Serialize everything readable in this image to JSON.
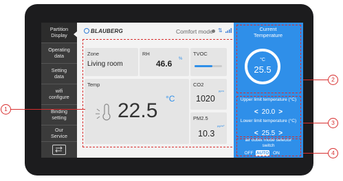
{
  "sidebar": {
    "items": [
      {
        "label": "Partition Display"
      },
      {
        "label": "Operating data"
      },
      {
        "label": "Setting data"
      },
      {
        "label": "wifi configure"
      },
      {
        "label": "Binding setting"
      },
      {
        "label": "Our Service"
      }
    ]
  },
  "header": {
    "brand": "BLAUBERG",
    "mode": "Comfort mode"
  },
  "cards": {
    "zone": {
      "label": "Zone",
      "value": "Living room"
    },
    "rh": {
      "label": "RH",
      "value": "46.6",
      "unit": "%"
    },
    "tvoc": {
      "label": "TVOC",
      "level": 0.65
    },
    "temp": {
      "label": "Temp",
      "value": "22.5",
      "unit": "°C"
    },
    "co2": {
      "label": "CO2",
      "value": "1020",
      "unit": "ppm"
    },
    "pm25": {
      "label": "PM2.5",
      "value": "10.3",
      "unit": "μg/m³"
    }
  },
  "panel": {
    "title": "Current Temperature",
    "unit": "°C",
    "current": "25.5",
    "upper_label": "Upper limit temperature (°C)",
    "upper_value": "20.0",
    "lower_label": "Lower limit temperature (°C)",
    "lower_value": "25.5",
    "switch_label": "air outlet mode selector switch",
    "switch_options": {
      "off": "OFF",
      "auto": "AUTO",
      "on": "ON"
    }
  },
  "callouts": [
    "1",
    "2",
    "3",
    "4"
  ],
  "colors": {
    "accent": "#2f8fe9",
    "annotation": "#d72d2d",
    "tvoc_bar": "#2f8fe9"
  }
}
